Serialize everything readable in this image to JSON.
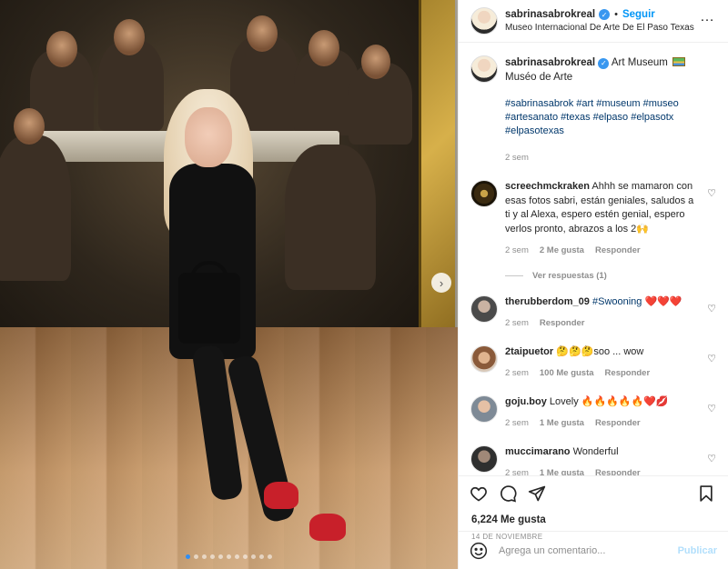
{
  "post": {
    "username": "sabrinasabrokreal",
    "follow_label": "Seguir",
    "location": "Museo Internacional De Arte De El Paso Texas",
    "caption_text": "Art Museum",
    "caption_after_icon": "Muséo de Arte",
    "hashtags": "#sabrinasabrok #art #museum #museo #artesanato #texas #elpaso #elpasotx #elpasotexas",
    "time": "2 sem",
    "likes": "6,224 Me gusta",
    "date": "14 DE NOVIEMBRE",
    "carousel": {
      "total_slides": 11,
      "active_index": 0
    }
  },
  "comments": [
    {
      "username": "screechmckraken",
      "text": "Ahhh se mamaron con esas fotos sabri, están geniales, saludos a ti y al Alexa, espero estén genial, espero verlos pronto, abrazos a los 2🙌",
      "time": "2 sem",
      "likes": "2 Me gusta",
      "reply": "Responder",
      "view_replies": "Ver respuestas (1)"
    },
    {
      "username": "therubberdom_09",
      "text_prefix": "",
      "mention": "#Swooning",
      "text_suffix": "❤️❤️❤️",
      "time": "2 sem",
      "reply": "Responder"
    },
    {
      "username": "2taipuetor",
      "text": "🤔🤔🤔soo ... wow",
      "time": "2 sem",
      "likes": "100 Me gusta",
      "reply": "Responder"
    },
    {
      "username": "goju.boy",
      "text": "Lovely 🔥🔥🔥🔥🔥❤️💋",
      "time": "2 sem",
      "likes": "1 Me gusta",
      "reply": "Responder"
    },
    {
      "username": "muccimarano",
      "text": "Wonderful",
      "time": "2 sem",
      "likes": "1 Me gusta",
      "reply": "Responder"
    }
  ],
  "composer": {
    "placeholder": "Agrega un comentario...",
    "post_label": "Publicar"
  },
  "icons": {
    "more": "more-options-icon",
    "verified": "verified-badge-icon",
    "heart": "heart-icon",
    "comment": "comment-icon",
    "share": "share-icon",
    "save": "bookmark-icon",
    "emoji": "emoji-icon",
    "next": "chevron-right-icon"
  },
  "colors": {
    "accent": "#0095f6",
    "link": "#00376b",
    "muted": "#8e8e8e",
    "active_dot": "#2f8ef5"
  }
}
